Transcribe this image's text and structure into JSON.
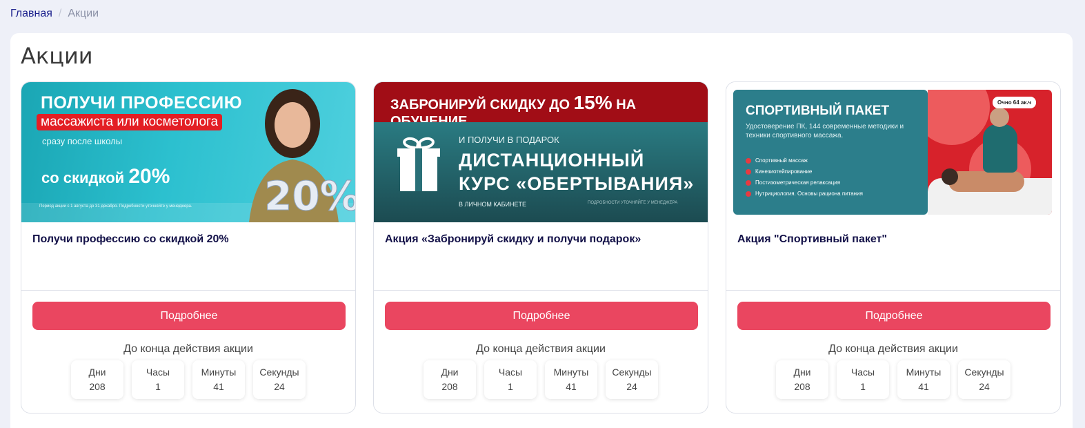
{
  "breadcrumb": {
    "home": "Главная",
    "current": "Акции"
  },
  "page": {
    "title": "Акции"
  },
  "colors": {
    "accent": "#ea4660",
    "title": "#131148",
    "link": "#1a1f8c"
  },
  "promos": [
    {
      "title": "Получи профессию со скидкой 20%",
      "button": "Подробнее",
      "countdown_label": "До конца действия акции",
      "timer": [
        {
          "label": "Дни",
          "value": "208"
        },
        {
          "label": "Часы",
          "value": "1"
        },
        {
          "label": "Минуты",
          "value": "41"
        },
        {
          "label": "Секунды",
          "value": "24"
        }
      ],
      "banner": {
        "headline": "ПОЛУЧИ ПРОФЕССИЮ",
        "highlight": "массажиста или косметолога",
        "sub": "сразу после школы",
        "discount_prefix": "со скидкой",
        "discount": "20%",
        "fine": "Период акции с 1 августа до 31 декабря. Подробности уточняйте у менеджера."
      }
    },
    {
      "title": "Акция «Забронируй скидку и получи подарок»",
      "button": "Подробнее",
      "countdown_label": "До конца действия акции",
      "timer": [
        {
          "label": "Дни",
          "value": "208"
        },
        {
          "label": "Часы",
          "value": "1"
        },
        {
          "label": "Минуты",
          "value": "41"
        },
        {
          "label": "Секунды",
          "value": "24"
        }
      ],
      "banner": {
        "top_prefix": "ЗАБРОНИРУЙ СКИДКУ ДО",
        "top_percent": "15%",
        "top_suffix": "НА ОБУЧЕНИЕ",
        "line1": "И ПОЛУЧИ В ПОДАРОК",
        "big1": "ДИСТАНЦИОННЫЙ",
        "big2": "КУРС «ОБЕРТЫВАНИЯ»",
        "small": "В ЛИЧНОМ КАБИНЕТЕ",
        "small2": "ПОДРОБНОСТИ УТОЧНЯЙТЕ У МЕНЕДЖЕРА"
      }
    },
    {
      "title": "Акция \"Спортивный пакет\"",
      "button": "Подробнее",
      "countdown_label": "До конца действия акции",
      "timer": [
        {
          "label": "Дни",
          "value": "208"
        },
        {
          "label": "Часы",
          "value": "1"
        },
        {
          "label": "Минуты",
          "value": "41"
        },
        {
          "label": "Секунды",
          "value": "24"
        }
      ],
      "banner": {
        "headline": "СПОРТИВНЫЙ ПАКЕТ",
        "desc": "Удостоверение ПК, 144 современные методики и техники спортивного массажа.",
        "items": [
          "Спортивный массаж",
          "Кинезиотейпирование",
          "Постизометрическая релаксация",
          "Нутрициология. Основы рациона питания"
        ],
        "tag": "Очно 64 ак.ч"
      }
    }
  ]
}
